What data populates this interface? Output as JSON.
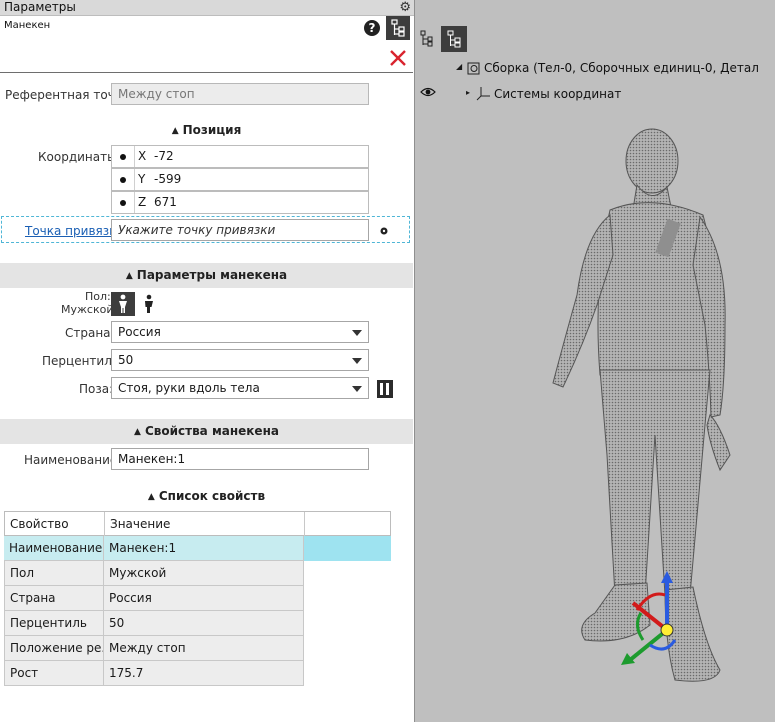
{
  "panel": {
    "title": "Параметры",
    "header_label": "Манекен",
    "help_glyph": "?",
    "ref_point_label": "Референтная точка:",
    "ref_point_value": "Между стоп",
    "position_section": "Позиция",
    "coordinates_label": "Координаты::",
    "coords": [
      {
        "axis": "X",
        "value": "-72"
      },
      {
        "axis": "Y",
        "value": "-599"
      },
      {
        "axis": "Z",
        "value": "671"
      }
    ],
    "anchor_link": "Точка привязки",
    "anchor_placeholder": "Укажите точку привязки",
    "manikin_params_section": "Параметры манекена",
    "sex_label": "Пол:",
    "sex_value": "Мужской",
    "country_label": "Страна:",
    "country_value": "Россия",
    "percentile_label": "Перцентиль:",
    "percentile_value": "50",
    "pose_label": "Поза:",
    "pose_value": "Стоя, руки вдоль тела",
    "manikin_props_section": "Свойства манекена",
    "name_label": "Наименование:",
    "name_value": "Манекен:1",
    "props_list_section": "Список свойств",
    "table": {
      "headers": [
        "Свойство",
        "Значение"
      ],
      "rows": [
        {
          "prop": "Наименование",
          "value": "Манекен:1",
          "selected": true
        },
        {
          "prop": "Пол",
          "value": "Мужской",
          "selected": false
        },
        {
          "prop": "Страна",
          "value": "Россия",
          "selected": false
        },
        {
          "prop": "Перцентиль",
          "value": "50",
          "selected": false
        },
        {
          "prop": "Положение ре...",
          "value": "Между стоп",
          "selected": false
        },
        {
          "prop": "Рост",
          "value": "175.7",
          "selected": false
        }
      ]
    }
  },
  "tree": {
    "root": "Сборка (Тел-0, Сборочных единиц-0, Детал",
    "child": "Системы координат"
  },
  "colors": {
    "selected_row": "#c7ecf0",
    "selected_row_ext": "#9ee3f0",
    "link": "#1a5fb4",
    "close": "#d9232e",
    "viewport_bg": "#bfbfbf"
  }
}
